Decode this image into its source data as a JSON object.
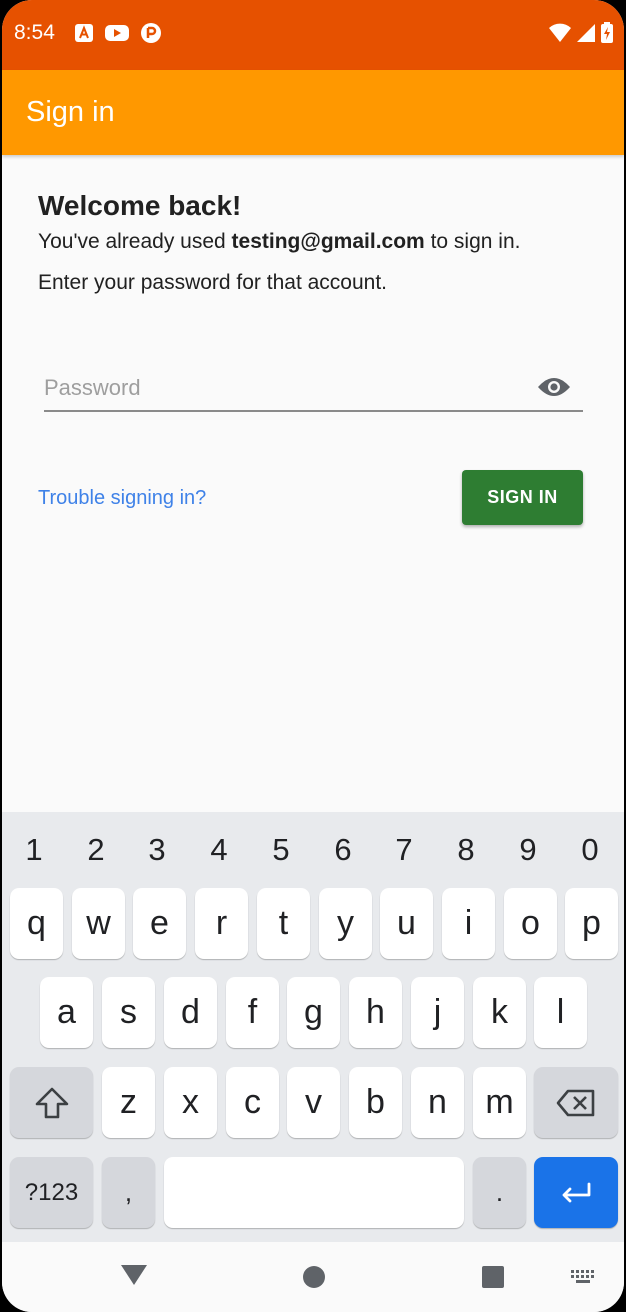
{
  "status_bar": {
    "time": "8:54",
    "notification_icons": [
      "a-badge-icon",
      "youtube-icon",
      "app-badge-icon"
    ],
    "right_icons": [
      "wifi-icon",
      "cell-signal-icon",
      "battery-icon"
    ],
    "bar_color": "#e65100"
  },
  "app_bar": {
    "title": "Sign in",
    "color": "#ff9800"
  },
  "content": {
    "heading": "Welcome back!",
    "line1_prefix": "You've already used ",
    "email": "testing@gmail.com",
    "line1_suffix": " to sign in.",
    "line2": "Enter your password for that account.",
    "password_placeholder": "Password",
    "trouble_link": "Trouble signing in?",
    "signin_button": "SIGN IN",
    "button_color": "#2e7d32",
    "link_color": "#3f82e8"
  },
  "keyboard": {
    "numbers": [
      "1",
      "2",
      "3",
      "4",
      "5",
      "6",
      "7",
      "8",
      "9",
      "0"
    ],
    "row1": [
      "q",
      "w",
      "e",
      "r",
      "t",
      "y",
      "u",
      "i",
      "o",
      "p"
    ],
    "row2": [
      "a",
      "s",
      "d",
      "f",
      "g",
      "h",
      "j",
      "k",
      "l"
    ],
    "row3": [
      "z",
      "x",
      "c",
      "v",
      "b",
      "n",
      "m"
    ],
    "symbols_key": "?123",
    "comma_key": ",",
    "period_key": ".",
    "enter_color": "#1a73e8"
  },
  "nav_bar": {
    "icons": [
      "back-triangle-icon",
      "home-circle-icon",
      "recents-square-icon",
      "keyboard-switch-icon"
    ]
  }
}
